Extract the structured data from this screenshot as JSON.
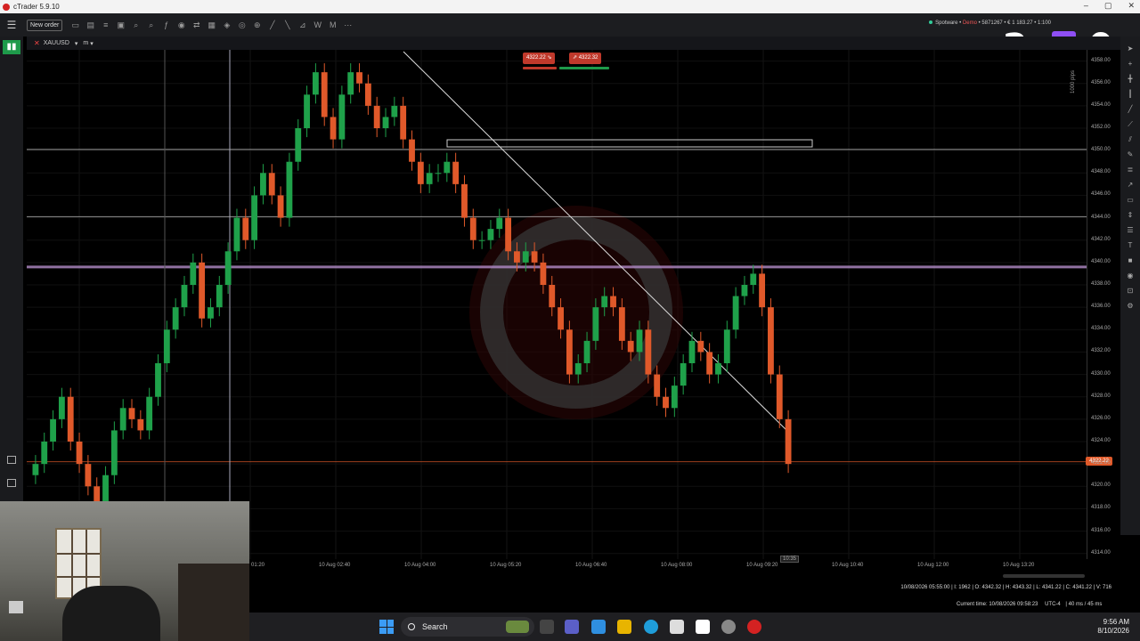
{
  "window": {
    "title": "cTrader 5.9.10",
    "controls": [
      "–",
      "▢",
      "✕"
    ]
  },
  "toolbar": {
    "menu_icon": "menu-icon",
    "new_order_label": "New order",
    "account_broker": "Spotware",
    "account_type": "Demo",
    "account_details": "• 5871267 • € 1 183.27 • 1:100"
  },
  "overlay": {
    "left_number": "2",
    "right_number": "0",
    "twitch_icon": "twitch-logo-icon"
  },
  "chart": {
    "symbol": "XAUUSD",
    "timeframe": "m",
    "sell_price": "4322.22",
    "buy_price": "4322.32",
    "scale_label": "1000 pips",
    "current_price": "4322.22",
    "hover_time": "10:35"
  },
  "chart_data": {
    "type": "candlestick",
    "price_ticks": [
      "4358.00",
      "4356.00",
      "4354.00",
      "4352.00",
      "4350.00",
      "4348.00",
      "4346.00",
      "4344.00",
      "4342.00",
      "4340.00",
      "4338.00",
      "4336.00",
      "4334.00",
      "4332.00",
      "4330.00",
      "4328.00",
      "4326.00",
      "4324.00",
      "4322.00",
      "4320.00",
      "4318.00",
      "4316.00",
      "4314.00"
    ],
    "ylim": [
      4313.5,
      4359
    ],
    "time_ticks": [
      "10 Aug 01:20",
      "10 Aug 02:40",
      "10 Aug 04:00",
      "10 Aug 05:20",
      "10 Aug 06:40",
      "10 Aug 08:00",
      "10 Aug 09:20",
      "10 Aug 10:40",
      "10 Aug 12:00",
      "10 Aug 13:20"
    ],
    "horizontal_levels": [
      4350.1,
      4344.1,
      4339.6,
      4322.2
    ],
    "closes": [
      4322,
      4324,
      4326,
      4328,
      4324,
      4322,
      4320,
      4318,
      4321,
      4325,
      4327,
      4326,
      4325,
      4328,
      4331,
      4334,
      4336,
      4338,
      4340,
      4335,
      4336,
      4338,
      4341,
      4344,
      4342,
      4346,
      4348,
      4346,
      4344,
      4349,
      4352,
      4355,
      4357,
      4353,
      4351,
      4355,
      4357,
      4356,
      4354,
      4352,
      4353,
      4354,
      4351,
      4349,
      4347,
      4348,
      4348,
      4349,
      4347,
      4344,
      4342,
      4342,
      4343,
      4344,
      4341,
      4340,
      4341,
      4340,
      4338,
      4336,
      4334,
      4330,
      4331,
      4333,
      4336,
      4337,
      4336,
      4333,
      4332,
      4334,
      4330,
      4328,
      4327,
      4329,
      4331,
      4333,
      4332,
      4330,
      4331,
      4334,
      4337,
      4338,
      4339,
      4336,
      4330,
      4326,
      4322
    ],
    "bullish_color": "#1fa14a",
    "bearish_color": "#e0592a"
  },
  "status": {
    "ohlc": "10/08/2026 05:55:00 | I: 1962 | O: 4342.32 | H: 4343.32 | L: 4341.22 | C: 4341.22 | V: 716",
    "current_time": "Current time: 10/08/2026 09:58:23",
    "timezone": "UTC-4",
    "latency": "| 40 ms / 45 ms"
  },
  "taskbar": {
    "search_label": "Search",
    "time": "9:56 AM",
    "date": "8/10/2026"
  }
}
